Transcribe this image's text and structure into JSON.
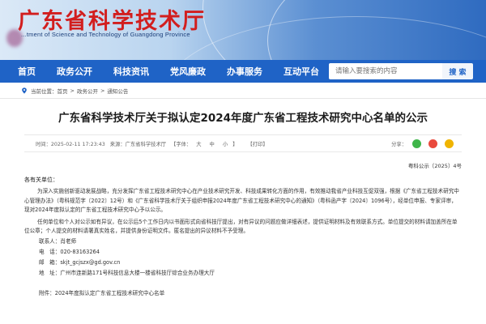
{
  "header": {
    "title": "广东省科学技术厅",
    "subtitle": "...tment of Science and Technology of Guangdong Province"
  },
  "nav": {
    "items": [
      "首页",
      "政务公开",
      "科技资讯",
      "党风廉政",
      "办事服务",
      "互动平台"
    ],
    "search_placeholder": "请输入要搜索的内容",
    "search_button": "搜 索"
  },
  "breadcrumb": {
    "prefix": "当前位置：",
    "items": [
      "首页",
      "政务公开",
      "通知公告"
    ]
  },
  "article": {
    "title": "广东省科学技术厅关于拟认定2024年度广东省工程技术研究中心名单的公示",
    "time": "时间：2025-02-11 17:23:43",
    "source": "来源：广东省科学技术厅",
    "font_size_prefix": "【字体：",
    "font_large": "大",
    "font_medium": "中",
    "font_small": "小",
    "font_size_suffix": "】",
    "print": "【打印】",
    "share_label": "分享：",
    "doc_number": "粤科公示〔2025〕4号",
    "salutation": "各有关单位：",
    "paragraph1": "为深入实施创新驱动发展战略，充分发挥广东省工程技术研究中心在产业技术研究开发、科技成果转化方面的作用，有效推动我省产业科技互促双强，根据《广东省工程技术研究中心管理办法》（粤科规范字〔2022〕12号）和《广东省科学技术厅关于组织申报2024年度广东省工程技术研究中心的通知》（粤科函产字〔2024〕1096号），经单位申报、专家评审，现对2024年度拟认定的广东省工程技术研究中心予以公示。",
    "paragraph2": "任何单位和个人对公示如有异议，在公示后5个工作日内以书面形式向省科技厅提出，对有异议的问题应做详细表述，提供证明材料及有效联系方式。单位提交的材料请加盖所在单位公章；个人提交的材料请署真实姓名，并提供身份证明文件。匿名提出的异议材料不予受理。",
    "contact_person": "联系人：肖老师",
    "phone": "电　话：020-83163264",
    "email": "邮　箱：skjt_gcjszx@gd.gov.cn",
    "address": "地　址：广州市连新路171号科技信息大楼一楼省科技厅综合业务办理大厅",
    "attachment": "附件：2024年度拟认定广东省工程技术研究中心名单"
  },
  "colors": {
    "title_red": "#d21e1e",
    "nav_blue": "#1f63c6",
    "share_wechat": "#3fb54a",
    "share_weibo": "#e94a3d",
    "share_qzone": "#f0b400"
  }
}
